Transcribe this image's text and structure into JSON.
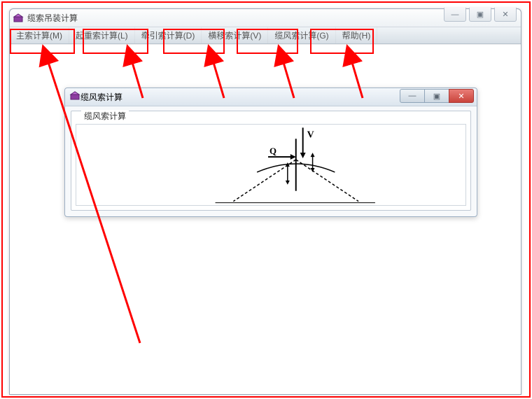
{
  "main_window": {
    "title": "缆索吊装计算"
  },
  "menu": {
    "items": [
      {
        "label": "主索计算(M)"
      },
      {
        "label": "起重索计算(L)"
      },
      {
        "label": "牵引索计算(D)"
      },
      {
        "label": "横移索计算(V)"
      },
      {
        "label": "缆风索计算(G)"
      },
      {
        "label": "帮助(H)"
      }
    ]
  },
  "child_window": {
    "title": "缆风索计算",
    "group_label": "缆风索计算",
    "diagram_labels": {
      "v": "V",
      "q": "Q"
    }
  },
  "win_controls": {
    "minimize": "—",
    "maximize": "▣",
    "close": "✕"
  }
}
